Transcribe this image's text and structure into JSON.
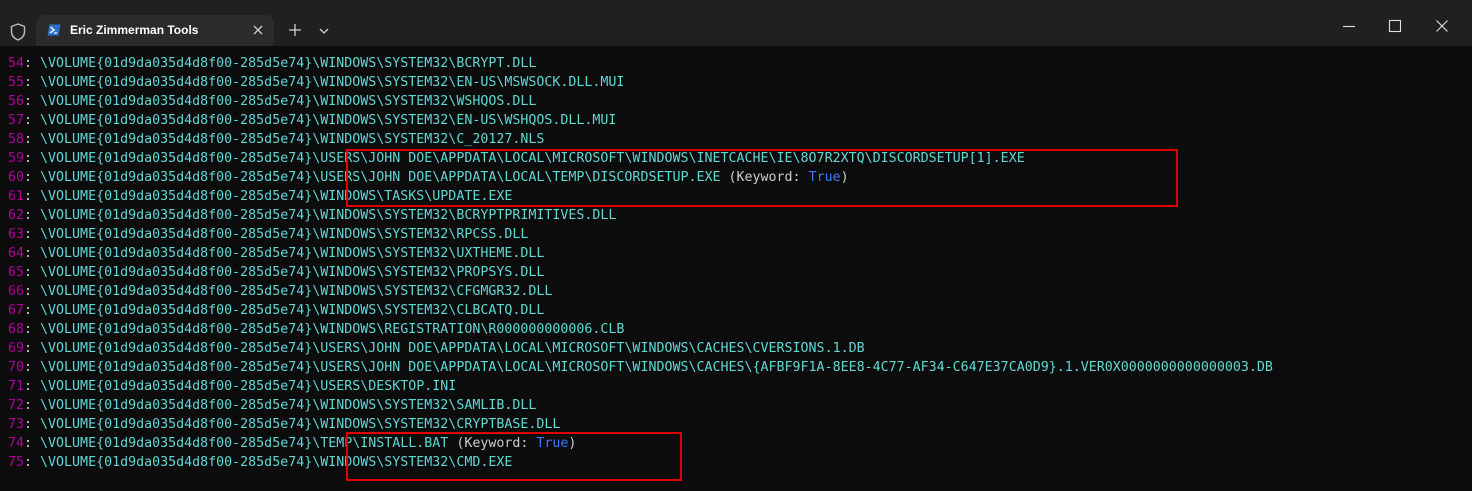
{
  "window": {
    "tab_title": "Eric Zimmerman Tools"
  },
  "icons": {
    "shield": "shield-icon",
    "powershell": "powershell-icon",
    "close_tab": "close-icon",
    "new_tab": "plus-icon",
    "dropdown": "chevron-down-icon",
    "minimize": "minimize-icon",
    "maximize": "maximize-icon",
    "close_window": "close-icon"
  },
  "colors": {
    "line_number": "#b4009e",
    "path": "#61d6d6",
    "keyword_label": "#cccccc",
    "keyword_value": "#3b78ff",
    "highlight_box": "#e00000"
  },
  "terminal": {
    "lines": [
      {
        "num": "54",
        "vol": "\\VOLUME{01d9da035d4d8f00-285d5e74}",
        "path": "\\WINDOWS\\SYSTEM32\\BCRYPT.DLL",
        "kw": "",
        "kwv": "",
        "kwend": ""
      },
      {
        "num": "55",
        "vol": "\\VOLUME{01d9da035d4d8f00-285d5e74}",
        "path": "\\WINDOWS\\SYSTEM32\\EN-US\\MSWSOCK.DLL.MUI",
        "kw": "",
        "kwv": "",
        "kwend": ""
      },
      {
        "num": "56",
        "vol": "\\VOLUME{01d9da035d4d8f00-285d5e74}",
        "path": "\\WINDOWS\\SYSTEM32\\WSHQOS.DLL",
        "kw": "",
        "kwv": "",
        "kwend": ""
      },
      {
        "num": "57",
        "vol": "\\VOLUME{01d9da035d4d8f00-285d5e74}",
        "path": "\\WINDOWS\\SYSTEM32\\EN-US\\WSHQOS.DLL.MUI",
        "kw": "",
        "kwv": "",
        "kwend": ""
      },
      {
        "num": "58",
        "vol": "\\VOLUME{01d9da035d4d8f00-285d5e74}",
        "path": "\\WINDOWS\\SYSTEM32\\C_20127.NLS",
        "kw": "",
        "kwv": "",
        "kwend": ""
      },
      {
        "num": "59",
        "vol": "\\VOLUME{01d9da035d4d8f00-285d5e74}",
        "path": "\\USERS\\JOHN DOE\\APPDATA\\LOCAL\\MICROSOFT\\WINDOWS\\INETCACHE\\IE\\8O7R2XTQ\\DISCORDSETUP[1].EXE",
        "kw": "",
        "kwv": "",
        "kwend": ""
      },
      {
        "num": "60",
        "vol": "\\VOLUME{01d9da035d4d8f00-285d5e74}",
        "path": "\\USERS\\JOHN DOE\\APPDATA\\LOCAL\\TEMP\\DISCORDSETUP.EXE",
        "kw": " (Keyword: ",
        "kwv": "True",
        "kwend": ")"
      },
      {
        "num": "61",
        "vol": "\\VOLUME{01d9da035d4d8f00-285d5e74}",
        "path": "\\WINDOWS\\TASKS\\UPDATE.EXE",
        "kw": "",
        "kwv": "",
        "kwend": ""
      },
      {
        "num": "62",
        "vol": "\\VOLUME{01d9da035d4d8f00-285d5e74}",
        "path": "\\WINDOWS\\SYSTEM32\\BCRYPTPRIMITIVES.DLL",
        "kw": "",
        "kwv": "",
        "kwend": ""
      },
      {
        "num": "63",
        "vol": "\\VOLUME{01d9da035d4d8f00-285d5e74}",
        "path": "\\WINDOWS\\SYSTEM32\\RPCSS.DLL",
        "kw": "",
        "kwv": "",
        "kwend": ""
      },
      {
        "num": "64",
        "vol": "\\VOLUME{01d9da035d4d8f00-285d5e74}",
        "path": "\\WINDOWS\\SYSTEM32\\UXTHEME.DLL",
        "kw": "",
        "kwv": "",
        "kwend": ""
      },
      {
        "num": "65",
        "vol": "\\VOLUME{01d9da035d4d8f00-285d5e74}",
        "path": "\\WINDOWS\\SYSTEM32\\PROPSYS.DLL",
        "kw": "",
        "kwv": "",
        "kwend": ""
      },
      {
        "num": "66",
        "vol": "\\VOLUME{01d9da035d4d8f00-285d5e74}",
        "path": "\\WINDOWS\\SYSTEM32\\CFGMGR32.DLL",
        "kw": "",
        "kwv": "",
        "kwend": ""
      },
      {
        "num": "67",
        "vol": "\\VOLUME{01d9da035d4d8f00-285d5e74}",
        "path": "\\WINDOWS\\SYSTEM32\\CLBCATQ.DLL",
        "kw": "",
        "kwv": "",
        "kwend": ""
      },
      {
        "num": "68",
        "vol": "\\VOLUME{01d9da035d4d8f00-285d5e74}",
        "path": "\\WINDOWS\\REGISTRATION\\R000000000006.CLB",
        "kw": "",
        "kwv": "",
        "kwend": ""
      },
      {
        "num": "69",
        "vol": "\\VOLUME{01d9da035d4d8f00-285d5e74}",
        "path": "\\USERS\\JOHN DOE\\APPDATA\\LOCAL\\MICROSOFT\\WINDOWS\\CACHES\\CVERSIONS.1.DB",
        "kw": "",
        "kwv": "",
        "kwend": ""
      },
      {
        "num": "70",
        "vol": "\\VOLUME{01d9da035d4d8f00-285d5e74}",
        "path": "\\USERS\\JOHN DOE\\APPDATA\\LOCAL\\MICROSOFT\\WINDOWS\\CACHES\\{AFBF9F1A-8EE8-4C77-AF34-C647E37CA0D9}.1.VER0X0000000000000003.DB",
        "kw": "",
        "kwv": "",
        "kwend": ""
      },
      {
        "num": "71",
        "vol": "\\VOLUME{01d9da035d4d8f00-285d5e74}",
        "path": "\\USERS\\DESKTOP.INI",
        "kw": "",
        "kwv": "",
        "kwend": ""
      },
      {
        "num": "72",
        "vol": "\\VOLUME{01d9da035d4d8f00-285d5e74}",
        "path": "\\WINDOWS\\SYSTEM32\\SAMLIB.DLL",
        "kw": "",
        "kwv": "",
        "kwend": ""
      },
      {
        "num": "73",
        "vol": "\\VOLUME{01d9da035d4d8f00-285d5e74}",
        "path": "\\WINDOWS\\SYSTEM32\\CRYPTBASE.DLL",
        "kw": "",
        "kwv": "",
        "kwend": ""
      },
      {
        "num": "74",
        "vol": "\\VOLUME{01d9da035d4d8f00-285d5e74}",
        "path": "\\TEMP\\INSTALL.BAT",
        "kw": " (Keyword: ",
        "kwv": "True",
        "kwend": ")"
      },
      {
        "num": "75",
        "vol": "\\VOLUME{01d9da035d4d8f00-285d5e74}",
        "path": "\\WINDOWS\\SYSTEM32\\CMD.EXE",
        "kw": "",
        "kwv": "",
        "kwend": ""
      }
    ]
  }
}
